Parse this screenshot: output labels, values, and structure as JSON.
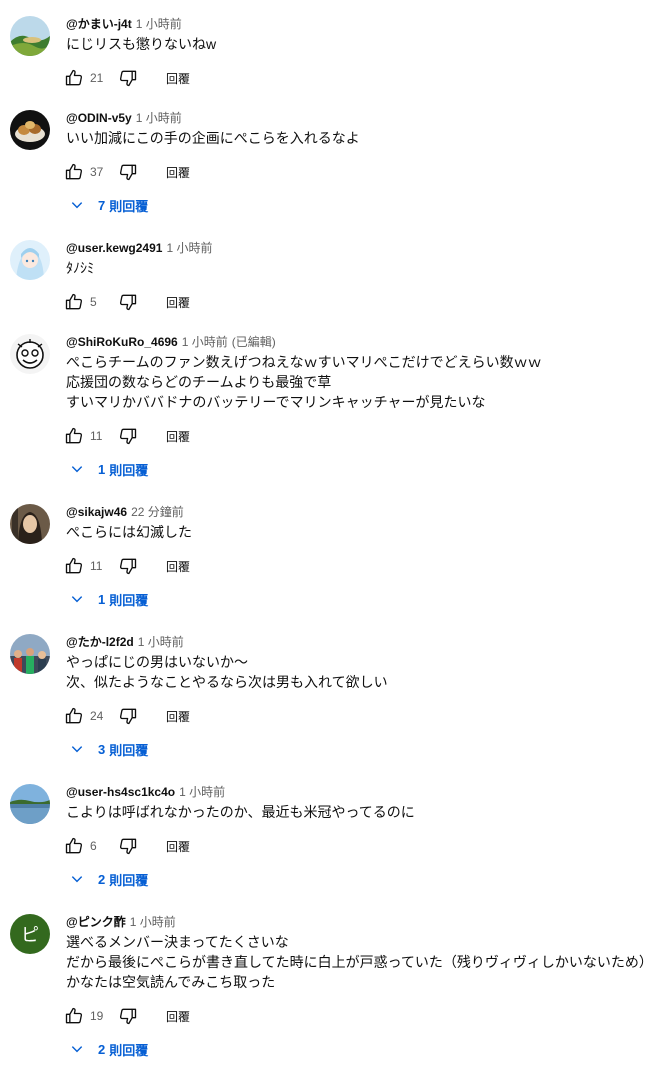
{
  "reply_label": "回覆",
  "comments": [
    {
      "author": "@かまい-j4t",
      "time": "1 小時前",
      "edited": "",
      "lines": "にじリスも懲りないねw",
      "likes": "21",
      "reply_count": "",
      "reply_word": "",
      "avatar": "landscape-avatar"
    },
    {
      "author": "@ODIN-v5y",
      "time": "1 小時前",
      "edited": "",
      "lines": "いい加減にこの手の企画にぺこらを入れるなよ",
      "likes": "37",
      "reply_count": "7",
      "reply_word": "則回覆",
      "avatar": "food-avatar"
    },
    {
      "author": "@user.kewg2491",
      "time": "1 小時前",
      "edited": "",
      "lines": "ﾀﾉｼﾐ",
      "likes": "5",
      "reply_count": "",
      "reply_word": "",
      "avatar": "anime-avatar"
    },
    {
      "author": "@ShiRoKuRo_4696",
      "time": "1 小時前",
      "edited": "(已編輯)",
      "lines": "ぺこらチームのファン数えげつねえなｗすいマリぺこだけでどえらい数ｗｗ\n応援団の数ならどのチームよりも最強で草\nすいマリかババドナのバッテリーでマリンキャッチャーが見たいな",
      "likes": "11",
      "reply_count": "1",
      "reply_word": "則回覆",
      "avatar": "sketch-face-avatar"
    },
    {
      "author": "@sikajw46",
      "time": "22 分鐘前",
      "edited": "",
      "lines": "ぺこらには幻滅した",
      "likes": "11",
      "reply_count": "1",
      "reply_word": "則回覆",
      "avatar": "portrait-avatar"
    },
    {
      "author": "@たか-l2f2d",
      "time": "1 小時前",
      "edited": "",
      "lines": "やっぱにじの男はいないか〜\n次、似たようなことやるなら次は男も入れて欲しい",
      "likes": "24",
      "reply_count": "3",
      "reply_word": "則回覆",
      "avatar": "crowd-avatar"
    },
    {
      "author": "@user-hs4sc1kc4o",
      "time": "1 小時前",
      "edited": "",
      "lines": "こよりは呼ばれなかったのか、最近も米冠やってるのに",
      "likes": "6",
      "reply_count": "2",
      "reply_word": "則回覆",
      "avatar": "lake-avatar"
    },
    {
      "author": "@ピンク酢",
      "time": "1 小時前",
      "edited": "",
      "lines": "選べるメンバー決まってたくさいな\nだから最後にぺこらが書き直してた時に白上が戸惑っていた（残りヴィヴィしかいないため）\nかなたは空気読んでみこち取った",
      "likes": "19",
      "reply_count": "2",
      "reply_word": "則回覆",
      "avatar": "letter-avatar",
      "avatar_letter": "ピ",
      "avatar_color": "#33691e"
    }
  ]
}
